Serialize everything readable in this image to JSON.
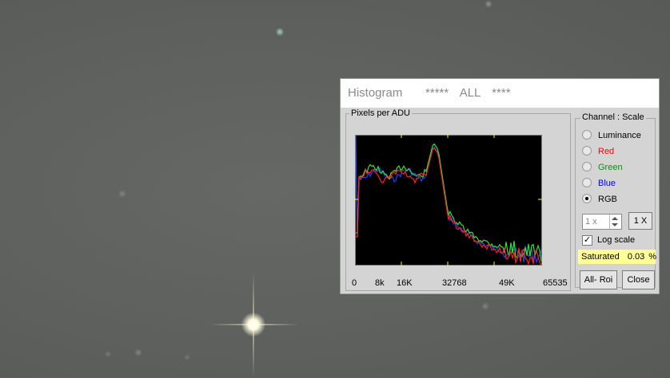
{
  "window": {
    "title": "Histogram    *****  ALL  ****"
  },
  "plot": {
    "group_label": "Pixels per ADU",
    "x_labels": [
      "0",
      "8k",
      "16K",
      "32768",
      "49K",
      "65535"
    ]
  },
  "channel": {
    "group_label": "Channel :  Scale",
    "options": [
      {
        "label": "Luminance",
        "color": "#000000",
        "checked": false
      },
      {
        "label": "Red",
        "color": "#ff0000",
        "checked": false
      },
      {
        "label": "Green",
        "color": "#009900",
        "checked": false
      },
      {
        "label": "Blue",
        "color": "#0000ff",
        "checked": false
      },
      {
        "label": "RGB",
        "color": "#000000",
        "checked": true
      }
    ],
    "zoom_value": "1 x",
    "zoom_reset_label": "1 X",
    "log_scale_label": "Log scale",
    "log_scale_checked": true,
    "check_mark": "✓"
  },
  "status": {
    "saturated_label": "Saturated",
    "saturated_value": "0.03 %"
  },
  "buttons": {
    "all_roi": "All- Roi",
    "close": "Close"
  },
  "colors": {
    "red": "#ff2020",
    "green": "#30e030",
    "blue": "#2040ff",
    "yellow_marker": "#ffff00"
  }
}
